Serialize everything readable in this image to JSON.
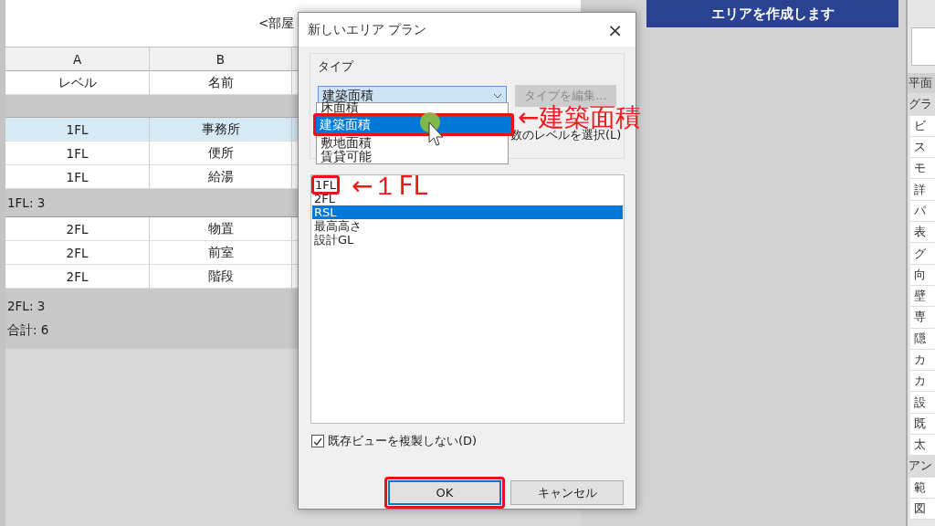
{
  "schedule": {
    "title": "<部屋",
    "columns": [
      "A",
      "B"
    ],
    "headers": [
      "レベル",
      "名前"
    ],
    "groups": [
      {
        "rows": [
          {
            "cells": [
              "1FL",
              "事務所"
            ],
            "selected": true
          },
          {
            "cells": [
              "1FL",
              "便所"
            ],
            "selected": false
          },
          {
            "cells": [
              "1FL",
              "給湯"
            ],
            "selected": false
          }
        ],
        "footer": "1FL: 3"
      },
      {
        "rows": [
          {
            "cells": [
              "2FL",
              "物置"
            ],
            "selected": false
          },
          {
            "cells": [
              "2FL",
              "前室"
            ],
            "selected": false
          },
          {
            "cells": [
              "2FL",
              "階段"
            ],
            "selected": false
          }
        ],
        "footer": "2FL: 3"
      }
    ],
    "total": "合計: 6"
  },
  "banner": {
    "text": "エリアを作成します"
  },
  "side_panel": {
    "items": [
      {
        "label": "平面",
        "kind": "header"
      },
      {
        "label": "グラ",
        "kind": "category"
      },
      {
        "label": "ビ",
        "kind": "item"
      },
      {
        "label": "ス",
        "kind": "item"
      },
      {
        "label": "モ",
        "kind": "item"
      },
      {
        "label": "詳",
        "kind": "item"
      },
      {
        "label": "パ",
        "kind": "item"
      },
      {
        "label": "表",
        "kind": "item"
      },
      {
        "label": "グ",
        "kind": "item"
      },
      {
        "label": "向",
        "kind": "item"
      },
      {
        "label": "壁",
        "kind": "item"
      },
      {
        "label": "専",
        "kind": "item"
      },
      {
        "label": "隠",
        "kind": "item"
      },
      {
        "label": "カ",
        "kind": "item"
      },
      {
        "label": "カ",
        "kind": "item"
      },
      {
        "label": "設",
        "kind": "item"
      },
      {
        "label": "既",
        "kind": "item"
      },
      {
        "label": "太",
        "kind": "item"
      },
      {
        "label": "アン",
        "kind": "category"
      },
      {
        "label": "範",
        "kind": "item"
      },
      {
        "label": "図",
        "kind": "item"
      }
    ]
  },
  "dialog": {
    "title": "新しいエリア プラン",
    "close": "×",
    "type_group": {
      "label": "タイプ",
      "combo_value": "建築面積",
      "edit_button": {
        "label": "タイプを編集...",
        "disabled": true
      },
      "dropdown": [
        {
          "label": "床面積",
          "selected": false,
          "highlighted": false
        },
        {
          "label": "建築面積",
          "selected": true,
          "highlighted": true
        },
        {
          "label": "敷地面積",
          "selected": false,
          "highlighted": false
        },
        {
          "label": "賃貸可能",
          "selected": false,
          "highlighted": false
        }
      ],
      "multi_level_label": "数のレベルを選択(L)"
    },
    "levels": [
      {
        "label": "1FL",
        "selected": false,
        "highlighted": true
      },
      {
        "label": "2FL",
        "selected": false,
        "highlighted": false
      },
      {
        "label": "RSL",
        "selected": true,
        "highlighted": false
      },
      {
        "label": "最高高さ",
        "selected": false,
        "highlighted": false
      },
      {
        "label": "設計GL",
        "selected": false,
        "highlighted": false
      }
    ],
    "checkbox": {
      "label": "既存ビューを複製しない(D)",
      "checked": true
    },
    "buttons": [
      {
        "label": "OK",
        "kind": "default",
        "highlighted": true
      },
      {
        "label": "キャンセル",
        "kind": "normal",
        "highlighted": false
      }
    ]
  },
  "annotations": [
    {
      "text": "←建築面積"
    },
    {
      "text": "←１FL"
    }
  ]
}
